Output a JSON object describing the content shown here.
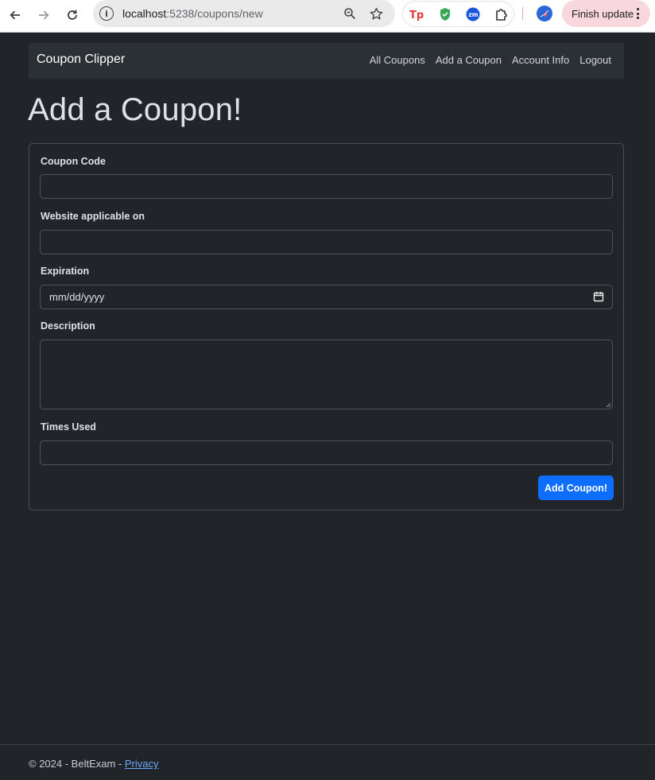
{
  "browser": {
    "url_host": "localhost",
    "url_rest": ":5238/coupons/new",
    "update_label": "Finish update",
    "icons": [
      "back-icon",
      "forward-icon",
      "reload-icon",
      "site-info-icon",
      "zoom-icon",
      "bookmark-star-icon",
      "toolbox-extension-icon",
      "shield-extension-icon",
      "zoom-extension-icon",
      "extensions-puzzle-icon",
      "profile-icon",
      "kebab-menu-icon"
    ]
  },
  "navbar": {
    "brand": "Coupon Clipper",
    "links": [
      "All Coupons",
      "Add a Coupon",
      "Account Info",
      "Logout"
    ]
  },
  "page": {
    "title": "Add a Coupon!"
  },
  "form": {
    "coupon_code": {
      "label": "Coupon Code",
      "value": ""
    },
    "website": {
      "label": "Website applicable on",
      "value": ""
    },
    "expiration": {
      "label": "Expiration",
      "placeholder": "mm/dd/yyyy"
    },
    "description": {
      "label": "Description",
      "value": ""
    },
    "times_used": {
      "label": "Times Used",
      "value": ""
    },
    "submit_label": "Add Coupon!"
  },
  "footer": {
    "text": "© 2024 - BeltExam - ",
    "privacy_link": "Privacy"
  },
  "colors": {
    "background": "#212529",
    "navbar": "#2b3035",
    "primary_button": "#0d6efd",
    "link": "#6ea8fe",
    "update_pill": "#f9d7de"
  }
}
